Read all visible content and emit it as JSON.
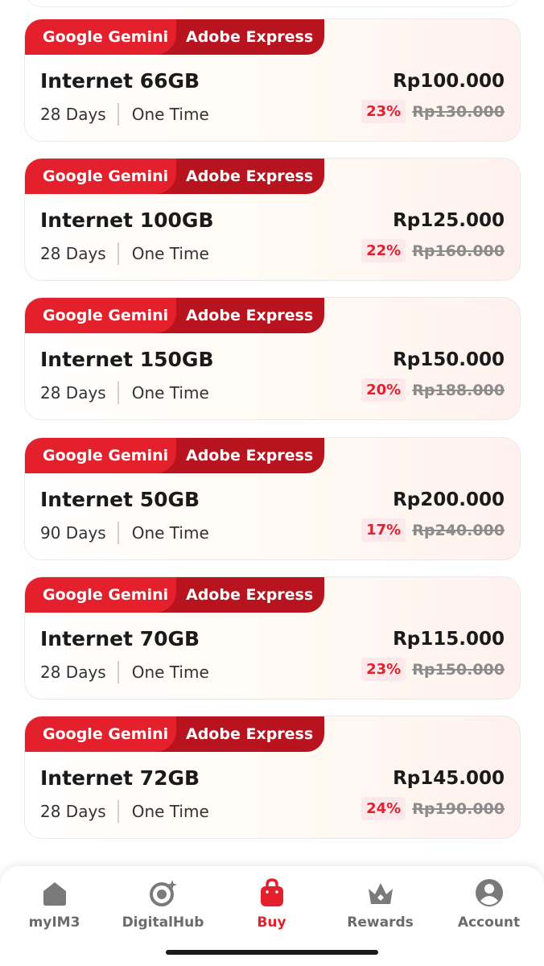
{
  "packages": [
    {
      "tag1": "Google Gemini",
      "tag2": "Adobe Express",
      "name": "Internet 66GB",
      "days": "28 Days",
      "type": "One Time",
      "price": "Rp100.000",
      "discount": "23%",
      "old_price": "Rp130.000"
    },
    {
      "tag1": "Google Gemini",
      "tag2": "Adobe Express",
      "name": "Internet 100GB",
      "days": "28 Days",
      "type": "One Time",
      "price": "Rp125.000",
      "discount": "22%",
      "old_price": "Rp160.000"
    },
    {
      "tag1": "Google Gemini",
      "tag2": "Adobe Express",
      "name": "Internet 150GB",
      "days": "28 Days",
      "type": "One Time",
      "price": "Rp150.000",
      "discount": "20%",
      "old_price": "Rp188.000"
    },
    {
      "tag1": "Google Gemini",
      "tag2": "Adobe Express",
      "name": "Internet 50GB",
      "days": "90 Days",
      "type": "One Time",
      "price": "Rp200.000",
      "discount": "17%",
      "old_price": "Rp240.000"
    },
    {
      "tag1": "Google Gemini",
      "tag2": "Adobe Express",
      "name": "Internet 70GB",
      "days": "28 Days",
      "type": "One Time",
      "price": "Rp115.000",
      "discount": "23%",
      "old_price": "Rp150.000"
    },
    {
      "tag1": "Google Gemini",
      "tag2": "Adobe Express",
      "name": "Internet 72GB",
      "days": "28 Days",
      "type": "One Time",
      "price": "Rp145.000",
      "discount": "24%",
      "old_price": "Rp190.000"
    }
  ],
  "nav": [
    {
      "label": "myIM3",
      "icon": "home-icon",
      "active": false
    },
    {
      "label": "DigitalHub",
      "icon": "digitalhub-icon",
      "active": false
    },
    {
      "label": "Buy",
      "icon": "shopping-bag-icon",
      "active": true
    },
    {
      "label": "Rewards",
      "icon": "crown-icon",
      "active": false
    },
    {
      "label": "Account",
      "icon": "account-icon",
      "active": false
    }
  ],
  "colors": {
    "accent_red": "#e3202c",
    "dark_red": "#b8141f",
    "inactive_icon": "#7a7a7a",
    "discount_bg": "#fde8eb"
  }
}
